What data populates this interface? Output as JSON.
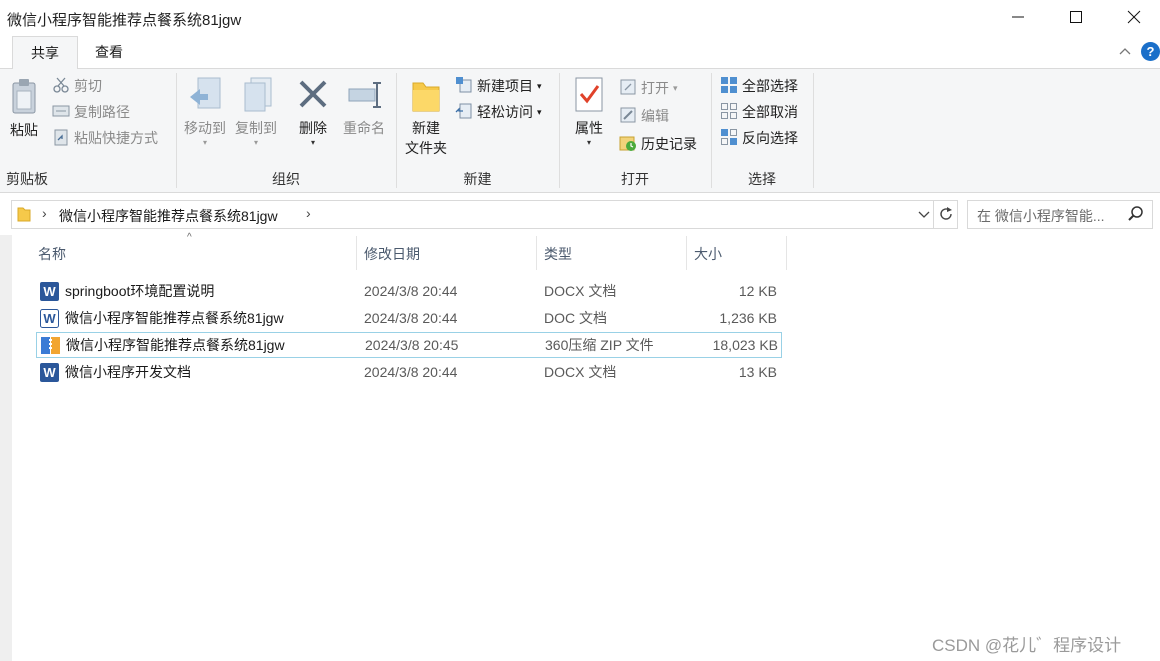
{
  "window": {
    "title": "微信小程序智能推荐点餐系统81jgw",
    "minimize_icon": "minimize-icon",
    "maximize_icon": "maximize-icon",
    "close_icon": "close-icon"
  },
  "tabs": [
    {
      "label": "共享"
    },
    {
      "label": "查看"
    }
  ],
  "ribbon": {
    "clipboard": {
      "group_label": "剪贴板",
      "paste": "粘贴",
      "cut": "剪切",
      "copy_path": "复制路径",
      "paste_shortcut": "粘贴快捷方式"
    },
    "organize": {
      "group_label": "组织",
      "move_to": "移动到",
      "copy_to": "复制到",
      "delete": "删除",
      "rename": "重命名"
    },
    "new": {
      "group_label": "新建",
      "new_folder_line1": "新建",
      "new_folder_line2": "文件夹",
      "new_item": "新建项目",
      "easy_access": "轻松访问"
    },
    "open": {
      "group_label": "打开",
      "properties": "属性",
      "open": "打开",
      "edit": "编辑",
      "history": "历史记录"
    },
    "select": {
      "group_label": "选择",
      "select_all": "全部选择",
      "select_none": "全部取消",
      "invert": "反向选择"
    }
  },
  "address": {
    "path": "微信小程序智能推荐点餐系统81jgw",
    "search_placeholder": "在 微信小程序智能..."
  },
  "list": {
    "columns": [
      "名称",
      "修改日期",
      "类型",
      "大小"
    ],
    "rows": [
      {
        "name": "springboot环境配置说明",
        "date": "2024/3/8 20:44",
        "type": "DOCX 文档",
        "size": "12 KB",
        "icon": "word-doc-icon"
      },
      {
        "name": "微信小程序智能推荐点餐系统81jgw",
        "date": "2024/3/8 20:44",
        "type": "DOC 文档",
        "size": "1,236 KB",
        "icon": "word-doc-icon"
      },
      {
        "name": "微信小程序智能推荐点餐系统81jgw",
        "date": "2024/3/8 20:45",
        "type": "360压缩 ZIP 文件",
        "size": "18,023 KB",
        "icon": "zip-archive-icon"
      },
      {
        "name": "微信小程序开发文档",
        "date": "2024/3/8 20:44",
        "type": "DOCX 文档",
        "size": "13 KB",
        "icon": "word-doc-icon"
      }
    ]
  },
  "watermark": "CSDN @花儿゛程序设计",
  "colors": {
    "accent": "#0078d7",
    "word_blue": "#2b579a",
    "selection_border": "#99d1e6"
  }
}
